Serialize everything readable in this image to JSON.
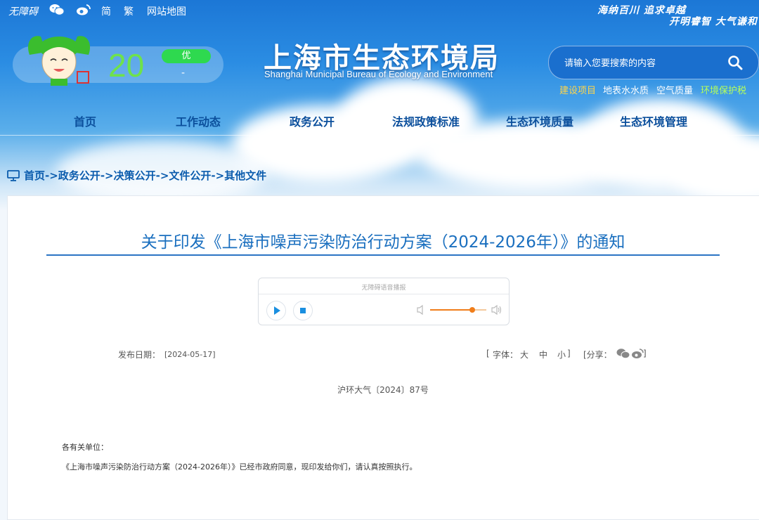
{
  "topbar": {
    "accessibility": "无障碍",
    "wechat_icon": "wechat-icon",
    "weibo_icon": "weibo-icon",
    "simplified": "简",
    "traditional": "繁",
    "sitemap": "网站地图",
    "slogan_line1": "海纳百川 追求卓越",
    "slogan_line2": "开明睿智 大气谦和"
  },
  "air_quality": {
    "value": "20",
    "level": "优",
    "pollutant": "-"
  },
  "site": {
    "title": "上海市生态环境局",
    "subtitle": "Shanghai Municipal Bureau of Ecology and Environment"
  },
  "search": {
    "placeholder": "请输入您要搜索的内容"
  },
  "quick_links": [
    {
      "label": "建设项目",
      "color": "#ffd54a"
    },
    {
      "label": "地表水水质",
      "color": "#ffffff"
    },
    {
      "label": "空气质量",
      "color": "#ffffff"
    },
    {
      "label": "环境保护税",
      "color": "#b6ff5a"
    }
  ],
  "nav": [
    "首页",
    "工作动态",
    "政务公开",
    "法规政策标准",
    "生态环境质量",
    "生态环境管理"
  ],
  "breadcrumb": [
    "首页",
    "->政务公开",
    "->决策公开",
    "->文件公开",
    "->其他文件"
  ],
  "article": {
    "title": "关于印发《上海市噪声污染防治行动方案（2024-2026年）》的通知",
    "player_label": "无障碍语音播报",
    "volume_level": 0.75,
    "date_label": "发布日期：",
    "date_value": "[2024-05-17]",
    "font_open": "[",
    "font_label": "字体：",
    "font_large": "大",
    "font_medium": "中",
    "font_small": "小",
    "font_close": "]",
    "share_open": "[分享：",
    "share_close": "]",
    "doc_number": "沪环大气〔2024〕87号",
    "salutation": "各有关单位：",
    "paragraph1": "《上海市噪声污染防治行动方案（2024-2026年）》已经市政府同意，现印发给你们，请认真按照执行。"
  },
  "colors": {
    "brand_blue": "#1a6fbf",
    "nav_text": "#0b4f9c",
    "aqi_green": "#6ee24b",
    "player_accent": "#1a8fe0",
    "volume_orange": "#f07d1a"
  }
}
